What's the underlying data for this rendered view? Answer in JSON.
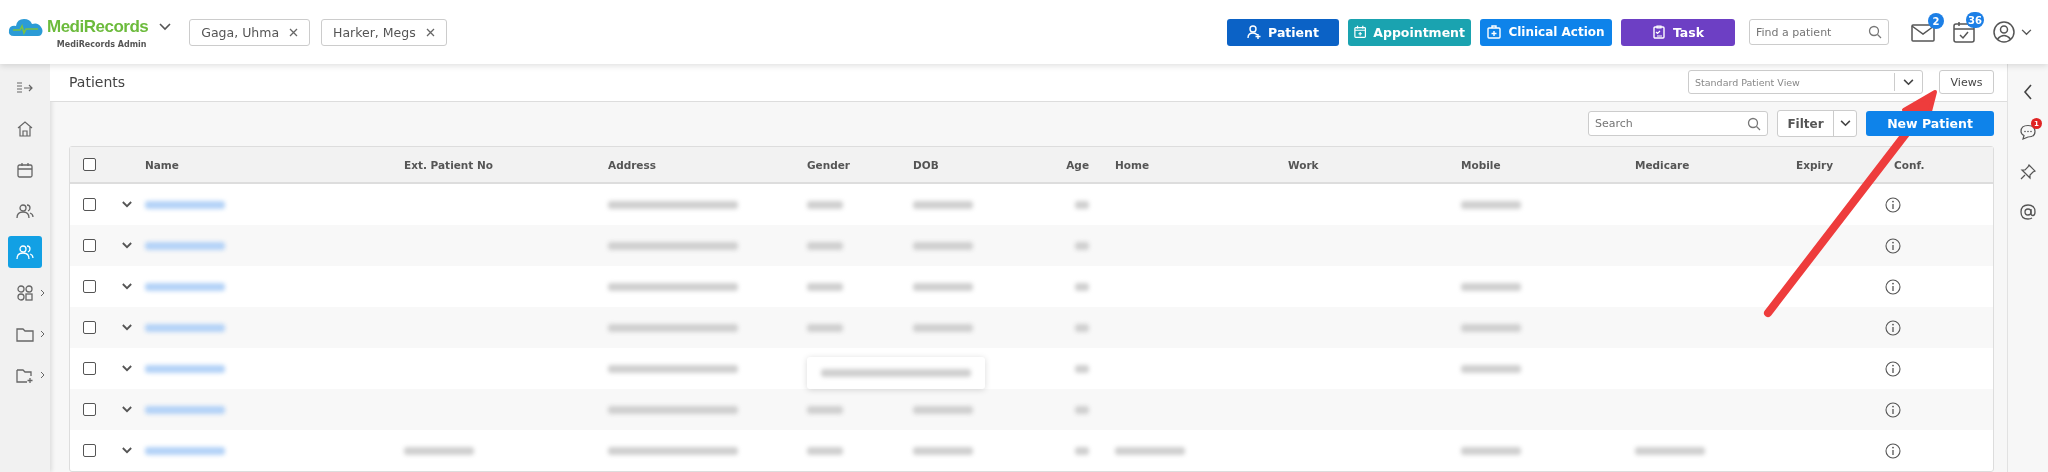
{
  "header": {
    "logo": {
      "name": "MediRecords",
      "subtitle": "MediRecords Admin"
    },
    "open_patients": [
      {
        "name": "Gaga, Uhma"
      },
      {
        "name": "Harker, Megs"
      }
    ],
    "actions": [
      {
        "kind": "patient",
        "label": "Patient"
      },
      {
        "kind": "appointment",
        "label": "Appointment"
      },
      {
        "kind": "clinical",
        "label": "Clinical Action"
      },
      {
        "kind": "task",
        "label": "Task"
      }
    ],
    "find_patient": {
      "placeholder": "Find a patient"
    },
    "messages_badge": "2",
    "tasks_badge": "36"
  },
  "sidebar": {
    "items": [
      {
        "kind": "collapse",
        "selected": false,
        "submenu": false
      },
      {
        "kind": "home",
        "selected": false,
        "submenu": false
      },
      {
        "kind": "calendar",
        "selected": false,
        "submenu": false
      },
      {
        "kind": "people",
        "selected": false,
        "submenu": false
      },
      {
        "kind": "patients",
        "selected": true,
        "submenu": false
      },
      {
        "kind": "groups",
        "selected": false,
        "submenu": true
      },
      {
        "kind": "folder",
        "selected": false,
        "submenu": true
      },
      {
        "kind": "folder-plus",
        "selected": false,
        "submenu": true
      }
    ]
  },
  "right_panel": {
    "chat_badge": "1"
  },
  "page": {
    "title": "Patients",
    "view_select": {
      "value": "Standard Patient View"
    },
    "views_button": "Views",
    "search": {
      "placeholder": "Search"
    },
    "filter_button": "Filter",
    "new_button": "New Patient"
  },
  "table": {
    "all_checked": false,
    "columns": [
      "Name",
      "Ext. Patient No",
      "Address",
      "Gender",
      "DOB",
      "Age",
      "Home",
      "Work",
      "Mobile",
      "Medicare",
      "Expiry",
      "Conf."
    ],
    "rows": [
      {
        "checked": false,
        "tooltip": false,
        "cells": {
          "name": {
            "kind": "blurred"
          },
          "address": {
            "kind": "blurred"
          },
          "gender": {
            "kind": "blurred"
          },
          "dob": {
            "kind": "blurred"
          },
          "age": {
            "kind": "blurred"
          },
          "mobile": {
            "kind": "blurred"
          }
        }
      },
      {
        "checked": false,
        "tooltip": false,
        "cells": {
          "name": {
            "kind": "blurred"
          },
          "address": {
            "kind": "blurred"
          },
          "gender": {
            "kind": "blurred"
          },
          "dob": {
            "kind": "blurred"
          },
          "age": {
            "kind": "blurred"
          }
        }
      },
      {
        "checked": false,
        "tooltip": false,
        "cells": {
          "name": {
            "kind": "blurred"
          },
          "address": {
            "kind": "blurred"
          },
          "gender": {
            "kind": "blurred"
          },
          "dob": {
            "kind": "blurred"
          },
          "age": {
            "kind": "blurred"
          },
          "mobile": {
            "kind": "blurred"
          }
        }
      },
      {
        "checked": false,
        "tooltip": false,
        "cells": {
          "name": {
            "kind": "blurred"
          },
          "address": {
            "kind": "blurred"
          },
          "gender": {
            "kind": "blurred"
          },
          "dob": {
            "kind": "blurred"
          },
          "age": {
            "kind": "blurred"
          },
          "mobile": {
            "kind": "blurred"
          }
        }
      },
      {
        "checked": false,
        "tooltip": true,
        "cells": {
          "name": {
            "kind": "blurred"
          },
          "address": {
            "kind": "blurred"
          },
          "age": {
            "kind": "blurred"
          },
          "mobile": {
            "kind": "blurred"
          }
        }
      },
      {
        "checked": false,
        "tooltip": false,
        "cells": {
          "name": {
            "kind": "blurred"
          },
          "address": {
            "kind": "blurred"
          },
          "gender": {
            "kind": "blurred"
          },
          "dob": {
            "kind": "blurred"
          },
          "age": {
            "kind": "blurred"
          }
        }
      },
      {
        "checked": false,
        "tooltip": false,
        "cells": {
          "name": {
            "kind": "blurred"
          },
          "ext_patient_no": {
            "kind": "blurred"
          },
          "address": {
            "kind": "blurred"
          },
          "gender": {
            "kind": "blurred"
          },
          "dob": {
            "kind": "blurred"
          },
          "age": {
            "kind": "blurred"
          },
          "home": {
            "kind": "blurred"
          },
          "mobile": {
            "kind": "blurred"
          },
          "medicare": {
            "kind": "blurred"
          }
        }
      }
    ]
  },
  "annotation": {
    "kind": "arrow"
  }
}
